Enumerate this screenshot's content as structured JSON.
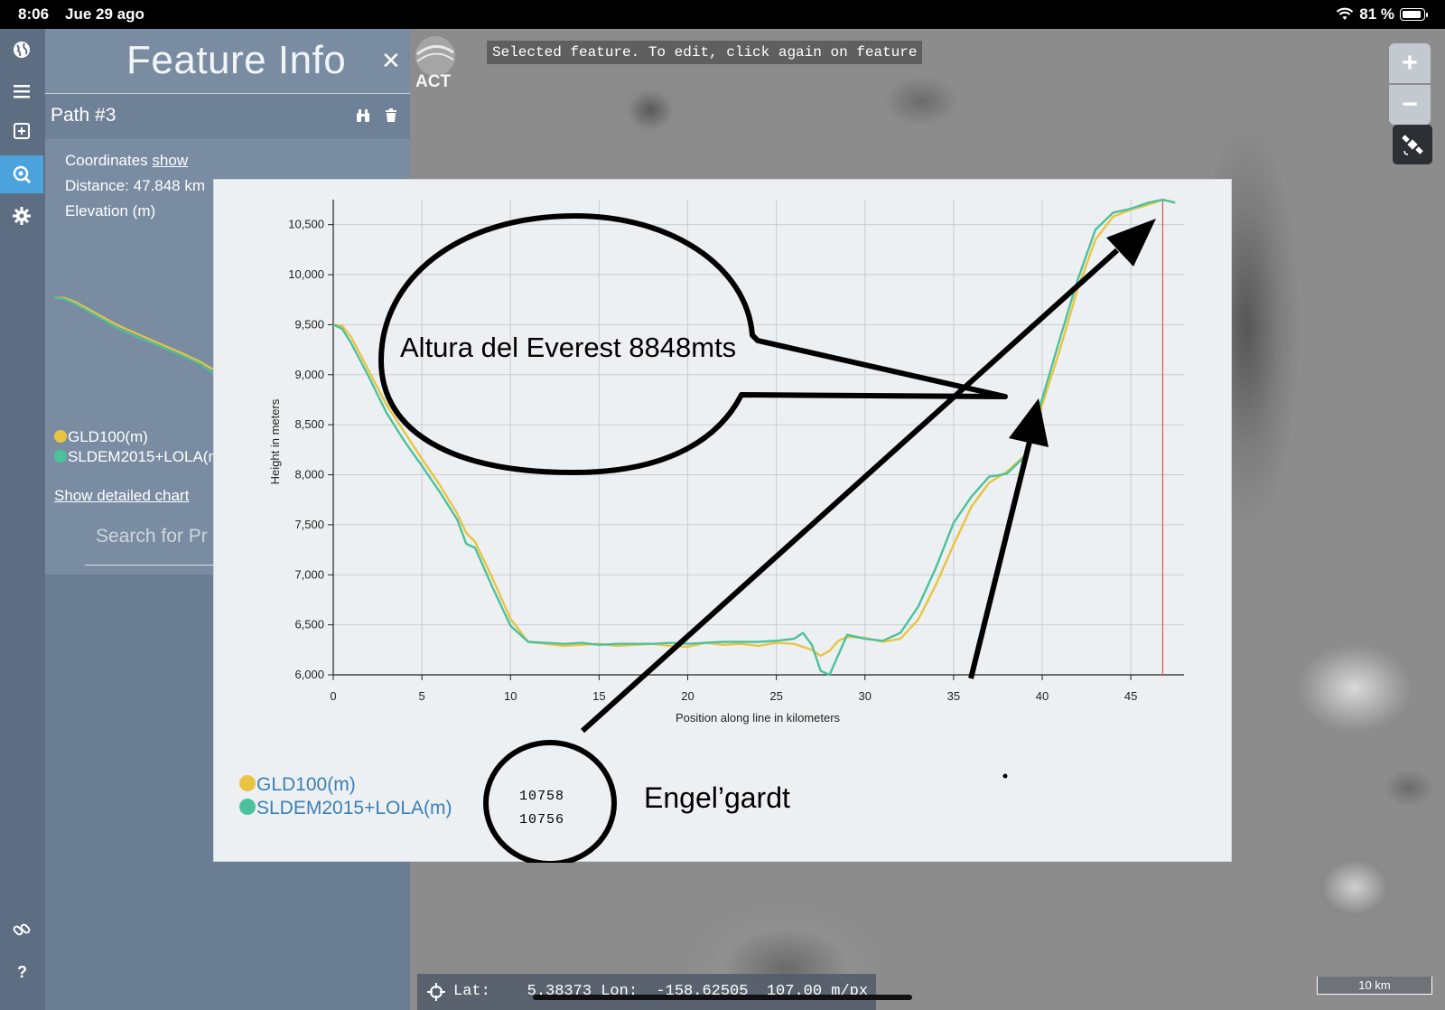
{
  "status_bar": {
    "time": "8:06",
    "date": "Jue 29 ago",
    "battery": "81 %"
  },
  "panel": {
    "title": "Feature Info",
    "close": "✕",
    "path_name": "Path #3",
    "coordinates_label": "Coordinates",
    "coordinates_link": "show",
    "distance_label": "Distance:",
    "distance_value": "47.848 km",
    "elevation_label": "Elevation (m)",
    "legend": [
      {
        "label": "GLD100(m)",
        "color": "#e9c440"
      },
      {
        "label": "SLDEM2015+LOLA(m)",
        "color": "#4cc19c"
      }
    ],
    "show_detailed_chart": "Show detailed chart",
    "search_placeholder": "Search for Pr"
  },
  "map": {
    "toast": "Selected feature. To edit, click again on feature",
    "logo_text": "ACT",
    "zoom_in": "+",
    "zoom_out": "−",
    "coords": "Lat:    5.38373 Lon:  -158.62505  107.00 m/px",
    "scale": "10 km"
  },
  "chart_data": {
    "type": "line",
    "xlabel": "Position along line in kilometers",
    "ylabel": "Height in meters",
    "xlim": [
      0,
      48
    ],
    "ylim": [
      6000,
      10750
    ],
    "x_ticks": [
      0,
      5,
      10,
      15,
      20,
      25,
      30,
      35,
      40,
      45
    ],
    "y_ticks": [
      6000,
      6500,
      7000,
      7500,
      8000,
      8500,
      9000,
      9500,
      10000,
      10500
    ],
    "y_tick_labels": [
      "6,000",
      "6,500",
      "7,000",
      "7,500",
      "8,000",
      "8,500",
      "9,000",
      "9,500",
      "10,000",
      "10,500"
    ],
    "marker_x": 46.8,
    "series": [
      {
        "name": "GLD100(m)",
        "color": "#e9c440",
        "x": [
          0,
          0.5,
          1,
          2,
          3,
          4,
          5,
          6,
          7,
          7.5,
          8,
          9,
          10,
          11,
          12,
          13,
          14,
          15,
          16,
          17,
          18,
          19,
          20,
          21,
          22,
          23,
          24,
          25,
          26,
          27,
          27.5,
          28,
          28.5,
          29,
          30,
          31,
          32,
          33,
          34,
          35,
          36,
          37,
          38,
          39,
          40,
          41,
          42,
          43,
          44,
          45,
          46,
          46.8,
          47.5
        ],
        "y": [
          9500,
          9490,
          9380,
          9040,
          8700,
          8430,
          8160,
          7900,
          7610,
          7420,
          7330,
          6960,
          6560,
          6330,
          6310,
          6290,
          6300,
          6310,
          6290,
          6300,
          6310,
          6290,
          6280,
          6320,
          6300,
          6310,
          6290,
          6320,
          6310,
          6250,
          6190,
          6240,
          6340,
          6380,
          6370,
          6330,
          6360,
          6550,
          6900,
          7300,
          7680,
          7920,
          8030,
          8190,
          8700,
          9250,
          9860,
          10350,
          10580,
          10650,
          10700,
          10750,
          10720
        ]
      },
      {
        "name": "SLDEM2015+LOLA(m)",
        "color": "#4cc19c",
        "x": [
          0,
          0.5,
          1,
          2,
          3,
          4,
          5,
          6,
          7,
          7.5,
          8,
          9,
          10,
          11,
          12,
          13,
          14,
          15,
          16,
          17,
          18,
          19,
          20,
          21,
          22,
          23,
          24,
          25,
          26,
          26.5,
          27,
          27.5,
          28,
          28.5,
          29,
          30,
          31,
          32,
          33,
          34,
          35,
          36,
          37,
          38,
          39,
          40,
          41,
          42,
          43,
          44,
          45,
          46,
          46.8,
          47.5
        ],
        "y": [
          9500,
          9460,
          9320,
          8980,
          8620,
          8340,
          8090,
          7830,
          7550,
          7310,
          7270,
          6870,
          6490,
          6330,
          6320,
          6310,
          6320,
          6300,
          6310,
          6310,
          6310,
          6320,
          6310,
          6320,
          6330,
          6330,
          6330,
          6340,
          6360,
          6420,
          6300,
          6040,
          6000,
          6200,
          6400,
          6360,
          6340,
          6420,
          6680,
          7070,
          7520,
          7780,
          7980,
          8010,
          8180,
          8760,
          9360,
          9950,
          10450,
          10620,
          10660,
          10720,
          10750,
          10720
        ]
      }
    ],
    "annotations": {
      "callout": "Altura del Everest 8848mts",
      "readouts": [
        "10758",
        "10756"
      ],
      "crater_name": "Engel’gardt"
    }
  },
  "dialog_legend": [
    {
      "label": "GLD100(m)",
      "color": "#e9c440"
    },
    {
      "label": "SLDEM2015+LOLA(m)",
      "color": "#4cc19c"
    }
  ]
}
